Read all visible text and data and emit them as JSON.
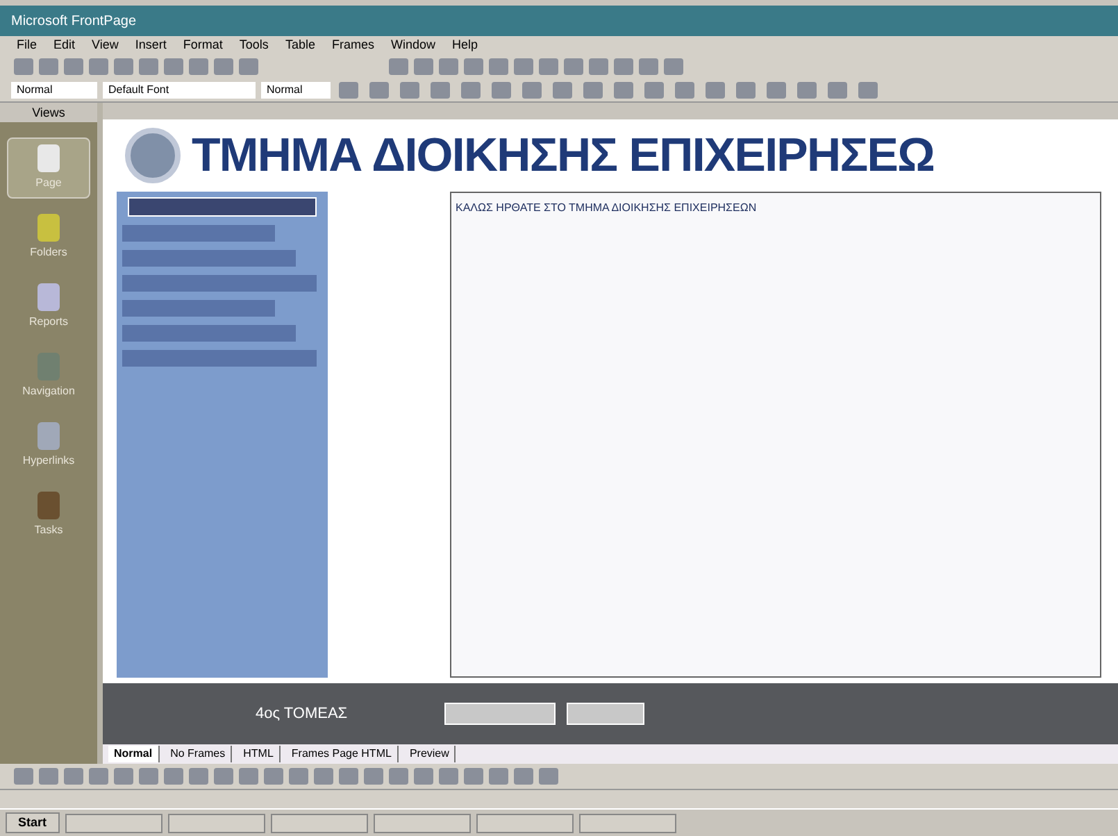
{
  "window": {
    "title": "Microsoft FrontPage"
  },
  "menu": [
    "File",
    "Edit",
    "View",
    "Insert",
    "Format",
    "Tools",
    "Table",
    "Frames",
    "Window",
    "Help"
  ],
  "format_bar": {
    "style": "Normal",
    "font": "Default Font",
    "size": "Normal"
  },
  "views_bar": {
    "title": "Views",
    "items": [
      {
        "label": "Page",
        "selected": true
      },
      {
        "label": "Folders",
        "selected": false
      },
      {
        "label": "Reports",
        "selected": false
      },
      {
        "label": "Navigation",
        "selected": false
      },
      {
        "label": "Hyperlinks",
        "selected": false
      },
      {
        "label": "Tasks",
        "selected": false
      }
    ]
  },
  "site_header": {
    "title": "ΤΜΗΜΑ ΔΙΟΙΚΗΣΗΣ ΕΠΙΧΕΙΡΗΣΕΩ"
  },
  "content": {
    "heading": "ΚΑΛΩΣ ΗΡΘΑΤΕ ΣΤΟ ΤΜΗΜΑ ΔΙΟΙΚΗΣΗΣ ΕΠΙΧΕΙΡΗΣΕΩΝ"
  },
  "footer": {
    "label": "4ος ΤΟΜΕΑΣ"
  },
  "view_tabs": [
    {
      "label": "Normal",
      "selected": true
    },
    {
      "label": "No Frames",
      "selected": false
    },
    {
      "label": "HTML",
      "selected": false
    },
    {
      "label": "Frames Page HTML",
      "selected": false
    },
    {
      "label": "Preview",
      "selected": false
    }
  ],
  "taskbar": {
    "start": "Start"
  }
}
